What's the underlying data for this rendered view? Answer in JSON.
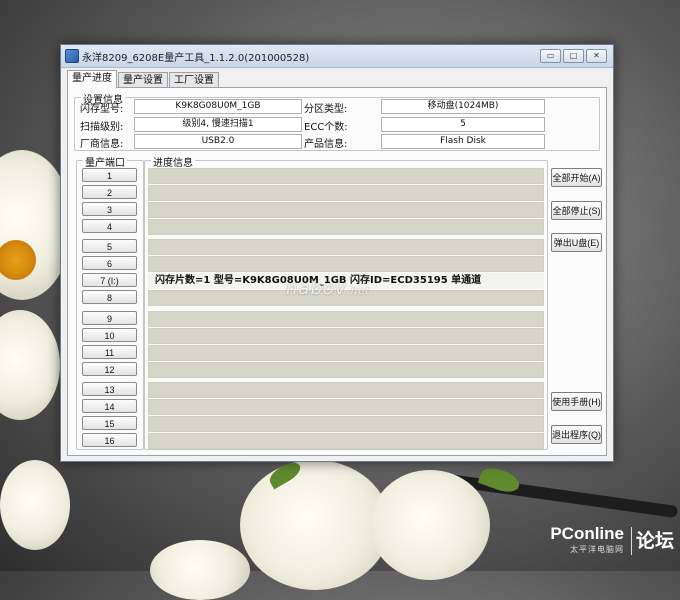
{
  "window": {
    "title": "永洋8209_6208E量产工具_1.1.2.0(201000528)",
    "min_label": "▭",
    "max_label": "□",
    "close_label": "✕"
  },
  "tabs": [
    {
      "label": "量产进度",
      "active": true
    },
    {
      "label": "量产设置",
      "active": false
    },
    {
      "label": "工厂设置",
      "active": false
    }
  ],
  "settings": {
    "group_title": "设置信息",
    "flash_model_label": "闪存型号:",
    "flash_model_value": "K9K8G08U0M_1GB",
    "scan_level_label": "扫描级别:",
    "scan_level_value": "级别4, 慢速扫描1",
    "vendor_label": "厂商信息:",
    "vendor_value": "USB2.0",
    "partition_label": "分区类型:",
    "partition_value": "移动盘(1024MB)",
    "ecc_label": "ECC个数:",
    "ecc_value": "5",
    "product_label": "产品信息:",
    "product_value": "Flash Disk"
  },
  "ports": {
    "group_title": "量产端口",
    "items": [
      "1",
      "2",
      "3",
      "4",
      "5",
      "6",
      "7 (I:)",
      "8",
      "9",
      "10",
      "11",
      "12",
      "13",
      "14",
      "15",
      "16"
    ]
  },
  "progress": {
    "group_title": "进度信息",
    "active_row_text": "闪存片数=1 型号=K9K8G08U0M_1GB 闪存ID=ECD35195 单通道"
  },
  "actions": {
    "start_all": "全部开始(A)",
    "stop_all": "全部停止(S)",
    "eject": "弹出U盘(E)",
    "manual": "使用手册(H)",
    "exit": "退出程序(Q)"
  },
  "watermark": {
    "main": "nabov",
    "suffix": ".net"
  },
  "branding": {
    "logo": "PConline",
    "logo_sub": "太平洋电脑网",
    "forum": "论坛"
  }
}
